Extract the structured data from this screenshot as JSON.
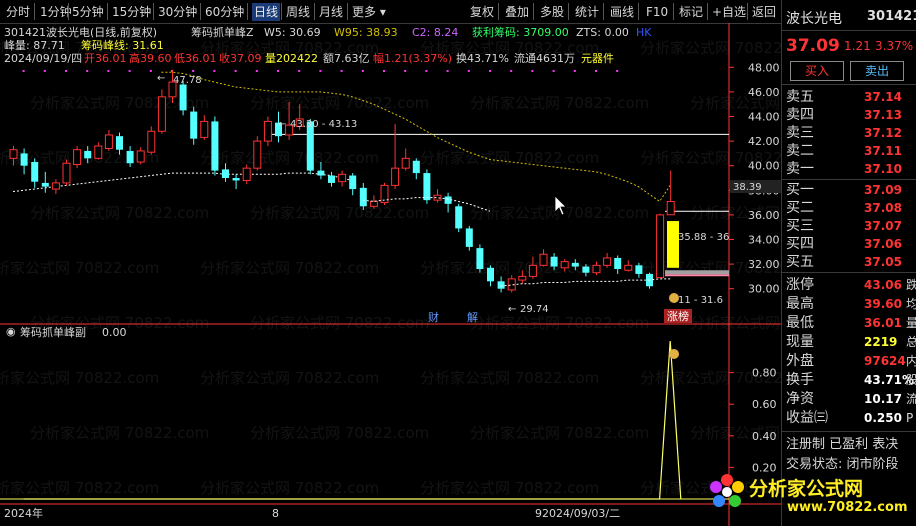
{
  "toolbar": {
    "periods": [
      "分时",
      "1分钟",
      "5分钟",
      "15分钟",
      "30分钟",
      "60分钟",
      "日线",
      "周线",
      "月线",
      "更多"
    ],
    "active_period": "日线",
    "tools": [
      "复权",
      "叠加",
      "多股",
      "统计",
      "画线",
      "F10",
      "标记",
      "+自选",
      "返回"
    ]
  },
  "main_chart": {
    "stock_code": "301421",
    "stock_title": "波长光电(日线,前复权)",
    "indicator_name": "筹码抓单峰Z",
    "w5_label": "W5: 30.69",
    "w95_label": "W95: 38.93",
    "c2_label": "C2: 8.24",
    "profit_label": "获利筹码: 3709.00",
    "zts_label": "ZTS: 0.00",
    "hk_label": "HK",
    "peak_volume_label": "峰量: 87.71",
    "peak_line_label": "筹码峰线: 31.61",
    "info_date": "2024/09/19/四",
    "info_open": "开36.01",
    "info_high": "高39.60",
    "info_low": "低36.01",
    "info_close": "收37.09",
    "info_volume": "量202422",
    "info_amount": "额7.63亿",
    "info_amplitude": "幅1.21(3.37%)",
    "info_turnover": "换43.71%",
    "info_float": "流通4631万",
    "info_sector": "元器件",
    "annotations": {
      "high_price": "47.78",
      "low_price": "29.74",
      "range_top": "43.30 - 43.13",
      "range_mid": "35.88 - 36",
      "range_low": "11 - 31.6",
      "current_price": "38.39",
      "marker_cai": "财",
      "marker_jie": "解",
      "limit_up": "涨榜"
    },
    "y_ticks": [
      "48.00",
      "46.00",
      "44.00",
      "42.00",
      "40.00",
      "38.00",
      "36.00",
      "34.00",
      "32.00",
      "30.00"
    ]
  },
  "sub_chart": {
    "indicator_label": "筹码抓单峰副",
    "indicator_value": "0.00",
    "y_ticks": [
      "0.80",
      "0.60",
      "0.40",
      "0.20"
    ]
  },
  "x_axis": {
    "labels": [
      "2024年",
      "8",
      "92024/09/03/二"
    ]
  },
  "chart_data": {
    "type": "candlestick",
    "ylim": [
      29,
      49
    ],
    "candles": [
      {
        "o": 40.6,
        "c": 41.3,
        "h": 41.6,
        "l": 40.0
      },
      {
        "o": 41.0,
        "c": 40.0,
        "h": 41.4,
        "l": 39.3
      },
      {
        "o": 40.3,
        "c": 38.7,
        "h": 40.6,
        "l": 38.2
      },
      {
        "o": 38.6,
        "c": 38.3,
        "h": 39.5,
        "l": 37.8
      },
      {
        "o": 38.1,
        "c": 38.6,
        "h": 38.9,
        "l": 37.7
      },
      {
        "o": 38.6,
        "c": 40.2,
        "h": 40.5,
        "l": 38.4
      },
      {
        "o": 40.1,
        "c": 41.3,
        "h": 41.6,
        "l": 39.8
      },
      {
        "o": 41.2,
        "c": 40.6,
        "h": 41.6,
        "l": 40.2
      },
      {
        "o": 40.6,
        "c": 41.6,
        "h": 41.9,
        "l": 40.5
      },
      {
        "o": 41.4,
        "c": 42.5,
        "h": 42.9,
        "l": 41.2
      },
      {
        "o": 42.4,
        "c": 41.3,
        "h": 42.7,
        "l": 40.9
      },
      {
        "o": 41.2,
        "c": 40.2,
        "h": 41.6,
        "l": 39.9
      },
      {
        "o": 40.3,
        "c": 41.2,
        "h": 41.5,
        "l": 40.1
      },
      {
        "o": 41.1,
        "c": 42.8,
        "h": 43.2,
        "l": 40.9
      },
      {
        "o": 42.8,
        "c": 45.6,
        "h": 46.2,
        "l": 42.6
      },
      {
        "o": 45.6,
        "c": 46.8,
        "h": 47.8,
        "l": 45.1
      },
      {
        "o": 46.6,
        "c": 44.5,
        "h": 46.9,
        "l": 44.1
      },
      {
        "o": 44.4,
        "c": 42.2,
        "h": 44.8,
        "l": 41.7
      },
      {
        "o": 42.3,
        "c": 43.6,
        "h": 44.1,
        "l": 42.1
      },
      {
        "o": 43.6,
        "c": 39.6,
        "h": 44.0,
        "l": 39.2
      },
      {
        "o": 39.7,
        "c": 39.0,
        "h": 40.2,
        "l": 38.7
      },
      {
        "o": 39.0,
        "c": 38.8,
        "h": 39.3,
        "l": 38.1
      },
      {
        "o": 38.8,
        "c": 39.8,
        "h": 40.1,
        "l": 38.5
      },
      {
        "o": 39.8,
        "c": 42.0,
        "h": 42.4,
        "l": 39.6
      },
      {
        "o": 42.0,
        "c": 43.6,
        "h": 44.0,
        "l": 41.6
      },
      {
        "o": 43.5,
        "c": 42.4,
        "h": 44.4,
        "l": 41.9
      },
      {
        "o": 42.5,
        "c": 43.3,
        "h": 45.2,
        "l": 42.1
      },
      {
        "o": 43.2,
        "c": 43.8,
        "h": 45.0,
        "l": 42.9
      },
      {
        "o": 43.6,
        "c": 39.6,
        "h": 43.8,
        "l": 39.3
      },
      {
        "o": 39.6,
        "c": 39.2,
        "h": 40.3,
        "l": 38.9
      },
      {
        "o": 39.2,
        "c": 38.6,
        "h": 39.5,
        "l": 38.3
      },
      {
        "o": 38.7,
        "c": 39.3,
        "h": 39.6,
        "l": 38.3
      },
      {
        "o": 39.2,
        "c": 38.1,
        "h": 39.4,
        "l": 37.6
      },
      {
        "o": 38.2,
        "c": 36.7,
        "h": 38.6,
        "l": 36.4
      },
      {
        "o": 36.7,
        "c": 37.1,
        "h": 37.6,
        "l": 36.5
      },
      {
        "o": 37.0,
        "c": 38.4,
        "h": 38.6,
        "l": 36.8
      },
      {
        "o": 38.4,
        "c": 39.8,
        "h": 43.4,
        "l": 38.1
      },
      {
        "o": 39.8,
        "c": 40.6,
        "h": 41.4,
        "l": 39.6
      },
      {
        "o": 40.4,
        "c": 39.4,
        "h": 40.6,
        "l": 38.9
      },
      {
        "o": 39.4,
        "c": 37.2,
        "h": 39.7,
        "l": 36.9
      },
      {
        "o": 37.2,
        "c": 37.6,
        "h": 38.1,
        "l": 37.0
      },
      {
        "o": 37.5,
        "c": 36.9,
        "h": 37.8,
        "l": 36.2
      },
      {
        "o": 36.7,
        "c": 34.9,
        "h": 36.9,
        "l": 34.6
      },
      {
        "o": 34.9,
        "c": 33.4,
        "h": 35.1,
        "l": 33.1
      },
      {
        "o": 33.3,
        "c": 31.6,
        "h": 33.6,
        "l": 31.3
      },
      {
        "o": 31.7,
        "c": 30.6,
        "h": 31.9,
        "l": 30.2
      },
      {
        "o": 30.6,
        "c": 30.0,
        "h": 31.0,
        "l": 29.7
      },
      {
        "o": 29.9,
        "c": 30.8,
        "h": 31.1,
        "l": 29.7
      },
      {
        "o": 30.7,
        "c": 31.0,
        "h": 31.5,
        "l": 30.4
      },
      {
        "o": 31.0,
        "c": 31.9,
        "h": 32.6,
        "l": 30.8
      },
      {
        "o": 31.9,
        "c": 32.8,
        "h": 33.2,
        "l": 31.8
      },
      {
        "o": 32.6,
        "c": 31.8,
        "h": 32.9,
        "l": 31.5
      },
      {
        "o": 31.7,
        "c": 32.2,
        "h": 32.4,
        "l": 31.4
      },
      {
        "o": 32.1,
        "c": 31.8,
        "h": 32.4,
        "l": 31.5
      },
      {
        "o": 31.8,
        "c": 31.3,
        "h": 32.0,
        "l": 31.0
      },
      {
        "o": 31.3,
        "c": 31.9,
        "h": 32.2,
        "l": 31.1
      },
      {
        "o": 31.9,
        "c": 32.5,
        "h": 32.9,
        "l": 31.7
      },
      {
        "o": 32.5,
        "c": 31.6,
        "h": 32.7,
        "l": 31.2
      },
      {
        "o": 31.5,
        "c": 31.9,
        "h": 32.3,
        "l": 31.4
      },
      {
        "o": 31.9,
        "c": 31.2,
        "h": 32.1,
        "l": 30.9
      },
      {
        "o": 31.2,
        "c": 30.2,
        "h": 31.3,
        "l": 30.0
      },
      {
        "o": 30.9,
        "c": 36.0,
        "h": 36.1,
        "l": 30.9
      },
      {
        "o": 36.01,
        "c": 37.09,
        "h": 39.6,
        "l": 36.01
      }
    ],
    "chip_line": [
      37.9,
      38.0,
      38.1,
      38.2,
      38.3,
      38.4,
      38.5,
      38.6,
      38.7,
      38.8,
      38.9,
      39.0,
      39.1,
      39.2,
      39.3,
      39.4,
      39.4,
      39.4,
      39.4,
      39.4,
      39.3,
      39.3,
      39.3,
      39.3,
      39.3,
      39.3,
      39.4,
      39.4,
      39.4,
      39.3,
      39.2,
      39.0,
      38.8,
      37.2,
      37.1,
      37.2,
      37.3,
      37.3,
      37.4,
      37.4,
      37.4,
      37.3,
      37.1,
      36.9,
      36.6,
      36.3,
      30.2,
      30.3,
      30.4,
      30.4,
      30.5,
      30.5,
      30.5,
      30.6,
      30.6,
      30.6,
      30.6,
      30.6,
      30.7,
      30.7,
      30.7,
      30.8,
      30.8
    ],
    "w95_line": [
      null,
      null,
      null,
      null,
      null,
      null,
      null,
      null,
      null,
      null,
      null,
      null,
      null,
      null,
      47.6,
      47.6,
      47.5,
      47.3,
      47.0,
      46.8,
      46.6,
      46.4,
      46.3,
      46.2,
      46.1,
      46.0,
      46.0,
      46.0,
      46.0,
      46.0,
      45.9,
      45.8,
      45.6,
      45.3,
      45.0,
      44.6,
      44.2,
      43.8,
      43.3,
      42.8,
      42.3,
      41.9,
      41.5,
      41.1,
      40.8,
      40.5,
      40.4,
      40.3,
      40.2,
      40.1,
      40.0,
      39.9,
      39.8,
      39.7,
      39.6,
      39.5,
      39.3,
      39.0,
      38.7,
      38.3,
      37.7,
      37.1,
      38.4
    ],
    "sub_values": [
      0,
      0,
      0,
      0,
      0,
      0,
      0,
      0,
      0,
      0,
      0,
      0,
      0,
      0,
      0,
      0,
      0,
      0,
      0,
      0,
      0,
      0,
      0,
      0,
      0,
      0,
      0,
      0,
      0,
      0,
      0,
      0,
      0,
      0,
      0,
      0,
      0,
      0,
      0,
      0,
      0,
      0,
      0,
      0,
      0,
      0,
      0,
      0,
      0,
      0,
      0,
      0,
      0,
      0,
      0,
      0,
      0,
      0,
      0,
      0,
      0,
      1.0,
      0
    ],
    "sub_ylim": [
      0,
      1.0
    ],
    "colors": {
      "up": "#ff3333",
      "down": "#54ffff",
      "chip": "#ffffff",
      "w95": "#d4c000",
      "axis": "#ff3333",
      "grid": "#2a2a2a"
    }
  },
  "quote_panel": {
    "name": "波长光电",
    "code": "301421",
    "price": "37.09",
    "change": "1.21",
    "change_pct": "3.37%",
    "buy_button": "买入",
    "sell_button": "卖出",
    "asks": [
      {
        "label": "卖五",
        "price": "37.14"
      },
      {
        "label": "卖四",
        "price": "37.13"
      },
      {
        "label": "卖三",
        "price": "37.12"
      },
      {
        "label": "卖二",
        "price": "37.11"
      },
      {
        "label": "卖一",
        "price": "37.10"
      }
    ],
    "bids": [
      {
        "label": "买一",
        "price": "37.09"
      },
      {
        "label": "买二",
        "price": "37.08"
      },
      {
        "label": "买三",
        "price": "37.07"
      },
      {
        "label": "买四",
        "price": "37.06"
      },
      {
        "label": "买五",
        "price": "37.05"
      }
    ],
    "stats": [
      {
        "label": "涨停",
        "value": "43.06",
        "extra": "跌",
        "color": "#ff3333"
      },
      {
        "label": "最高",
        "value": "39.60",
        "extra": "均",
        "color": "#ff3333"
      },
      {
        "label": "最低",
        "value": "36.01",
        "extra": "量",
        "color": "#ff3333"
      },
      {
        "label": "现量",
        "value": "2219",
        "extra": "总",
        "color": "#ffff33"
      },
      {
        "label": "外盘",
        "value": "97624",
        "extra": "内",
        "color": "#ff3333"
      },
      {
        "label": "换手",
        "value": "43.71%",
        "extra": "股",
        "color": "#ffffff"
      },
      {
        "label": "净资",
        "value": "10.17",
        "extra": "流",
        "color": "#ffffff"
      },
      {
        "label": "收益㈢",
        "value": "0.250",
        "extra": "P",
        "color": "#ffffff"
      }
    ],
    "status_line1": "注册制 已盈利 表决",
    "status_line2": "交易状态: 闭市阶段"
  },
  "logo": {
    "brand": "分析家公式网",
    "url": "www.70822.com"
  }
}
